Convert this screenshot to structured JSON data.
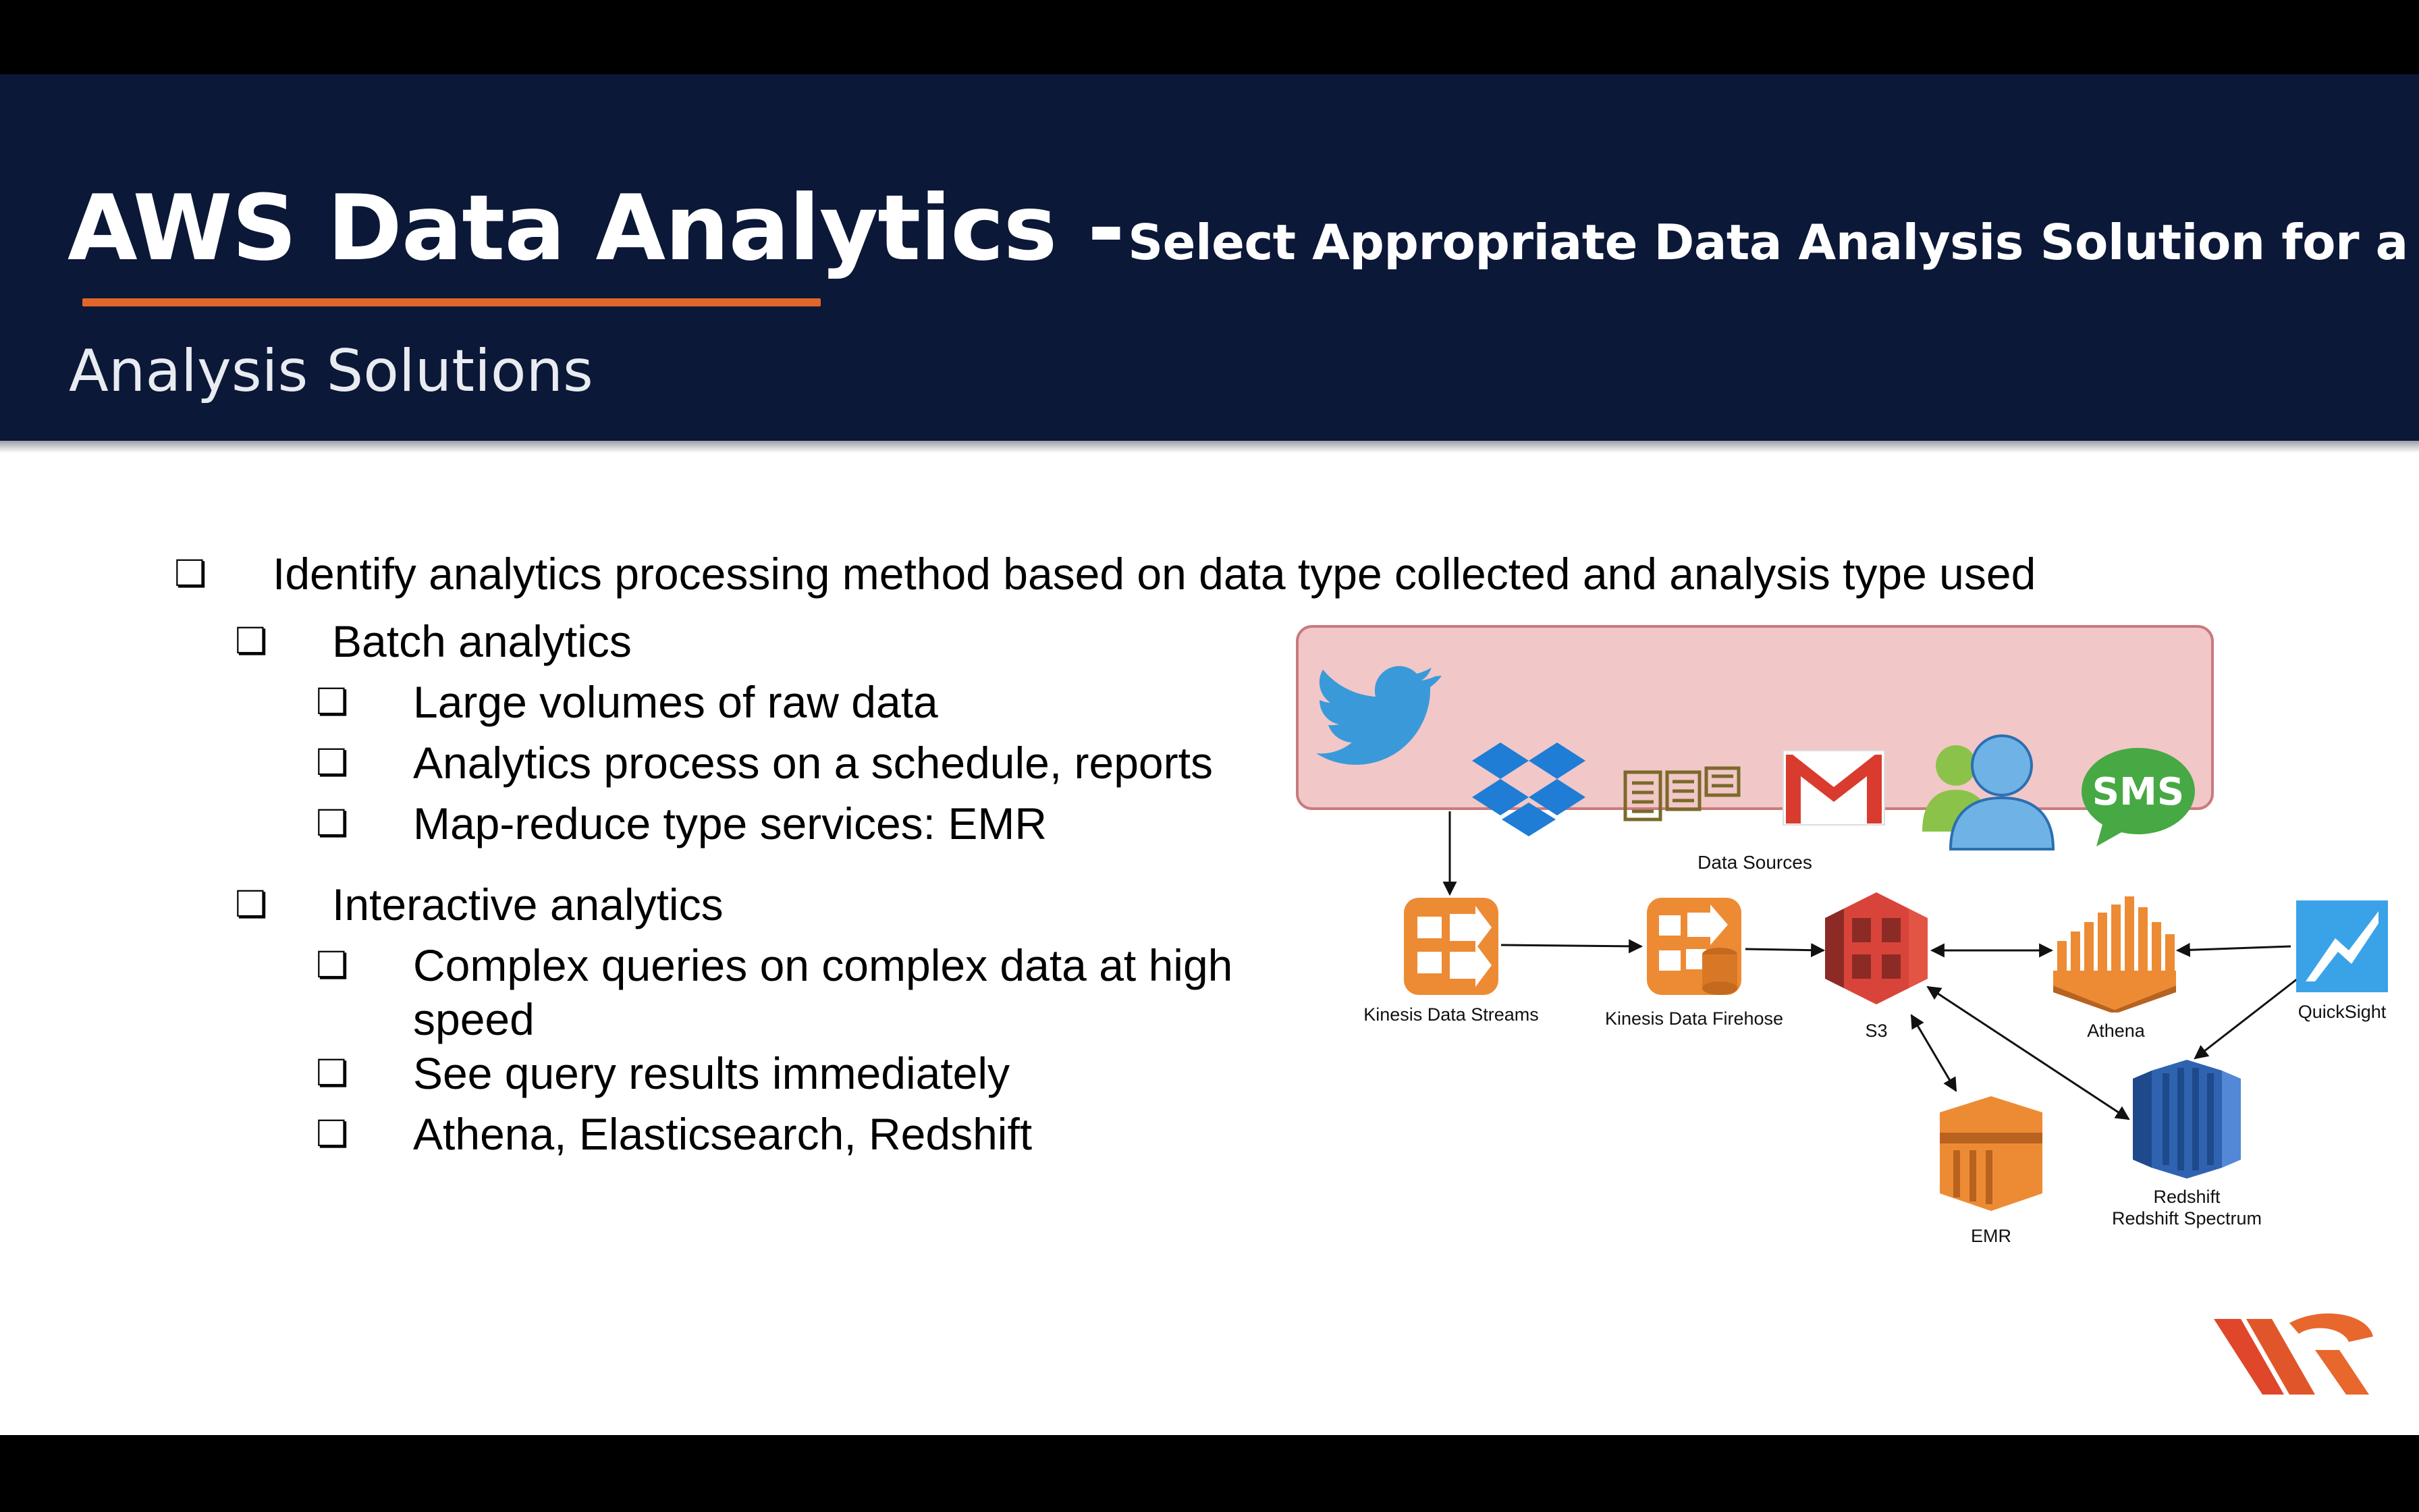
{
  "title": {
    "main": "AWS Data Analytics -",
    "sub": "Select Appropriate Data Analysis Solution for a Scenario"
  },
  "subtitle": "Analysis  Solutions",
  "bullets": {
    "checkbox_glyph": "❏",
    "top": "Identify analytics processing method based on data type collected and analysis type used",
    "batch": {
      "label": "Batch analytics",
      "items": [
        "Large volumes of raw data",
        "Analytics process on a schedule, reports",
        "Map-reduce type services: EMR"
      ]
    },
    "interactive": {
      "label": "Interactive analytics",
      "items": [
        "Complex queries on complex data at high",
        "speed",
        "See query results immediately",
        "Athena, Elasticsearch, Redshift"
      ]
    }
  },
  "diagram": {
    "data_sources_label": "Data Sources",
    "sources": [
      "twitter-icon",
      "dropbox-icon",
      "news-feed-icon",
      "gmail-icon",
      "users-icon",
      "sms-icon"
    ],
    "sms_text": "SMS",
    "services": {
      "kinesis_streams": "Kinesis Data Streams",
      "kinesis_firehose": "Kinesis Data Firehose",
      "s3": "S3",
      "athena": "Athena",
      "quicksight": "QuickSight",
      "emr": "EMR",
      "redshift": "Redshift",
      "redshift_spectrum": "Redshift Spectrum"
    }
  },
  "colors": {
    "header_bg": "#0b1838",
    "accent": "#e0672a",
    "ds_box_bg": "#f2c7c8",
    "aws_orange": "#ed8b34",
    "s3_red": "#d9443a",
    "redshift_blue": "#2f63b0",
    "quicksight_blue": "#3aa3e8"
  }
}
